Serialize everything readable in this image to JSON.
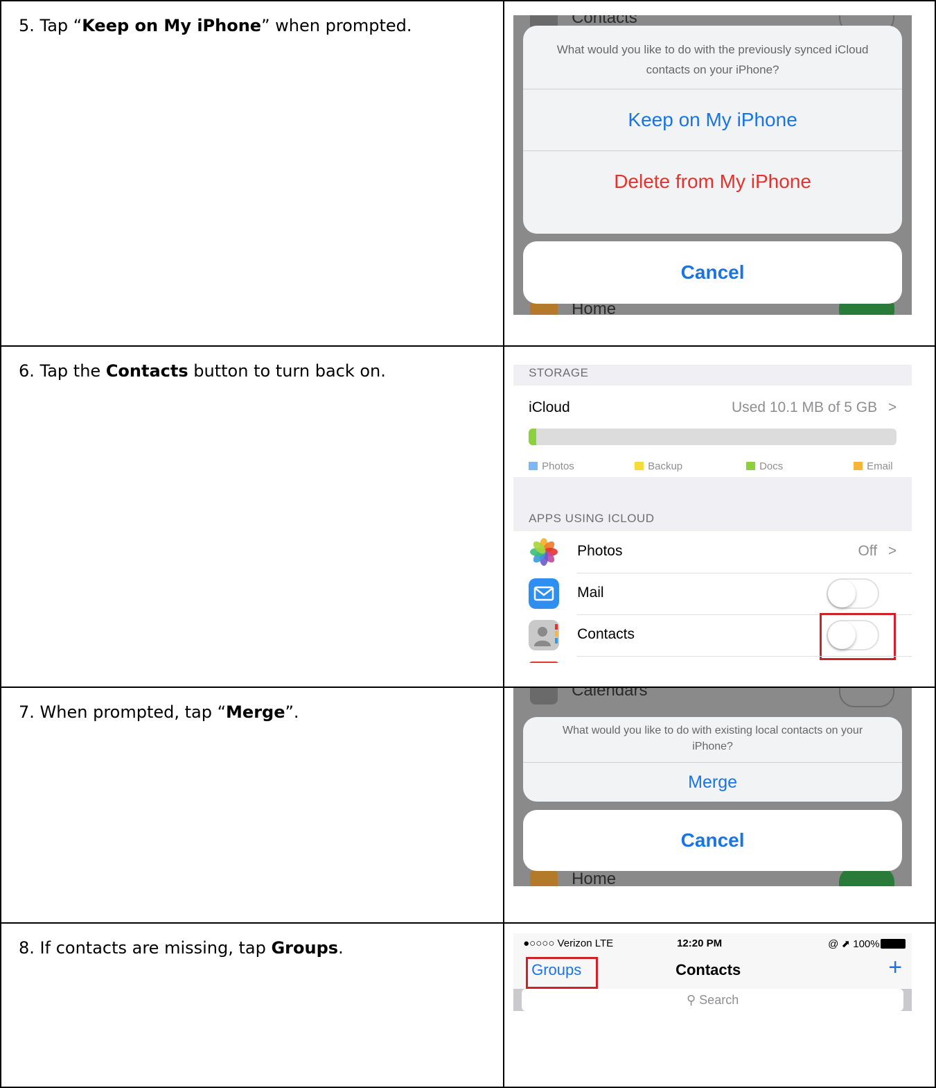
{
  "steps": [
    {
      "number": "5.",
      "text_before": " Tap “",
      "bold": "Keep on My iPhone",
      "text_after": "” when prompted.",
      "screen": {
        "top_item": "Contacts",
        "bottom_item": "Home",
        "message": "What would you like to do with the previously synced iCloud contacts on your iPhone?",
        "option_keep": "Keep on My iPhone",
        "option_delete": "Delete from My iPhone",
        "cancel": "Cancel"
      }
    },
    {
      "number": "6.",
      "text_before": " Tap the ",
      "bold": "Contacts",
      "text_after": " button to turn back on.",
      "screen": {
        "storage_header": "STORAGE",
        "icloud_label": "iCloud",
        "icloud_usage": "Used 10.1 MB of 5 GB",
        "usage_fraction": 0.02,
        "legend": [
          {
            "label": "Photos",
            "color": "#7fb8f0"
          },
          {
            "label": "Backup",
            "color": "#f5dc3a"
          },
          {
            "label": "Docs",
            "color": "#8ed03c"
          },
          {
            "label": "Email",
            "color": "#f6b63a"
          }
        ],
        "apps_header": "APPS USING ICLOUD",
        "apps": [
          {
            "label": "Photos",
            "value": "Off",
            "icon": "photos-icon"
          },
          {
            "label": "Mail",
            "icon": "mail-icon",
            "toggle": false
          },
          {
            "label": "Contacts",
            "icon": "contacts-icon",
            "toggle": false
          }
        ],
        "chevron": ">"
      }
    },
    {
      "number": "7.",
      "text_before": "  When prompted, tap “",
      "bold": "Merge",
      "text_after": "”.",
      "screen": {
        "top_item": "Calendars",
        "bottom_item": "Home",
        "message": "What would you like to do with existing local contacts on your iPhone?",
        "option_merge": "Merge",
        "cancel": "Cancel"
      }
    },
    {
      "number": "8.",
      "text_before": " If contacts are missing, tap ",
      "bold": "Groups",
      "text_after": ".",
      "screen": {
        "carrier": "●○○○○ Verizon  LTE",
        "time": "12:20 PM",
        "battery": "@ ⬈ 100%",
        "groups": "Groups",
        "title": "Contacts",
        "add": "+",
        "search_placeholder": "Search"
      }
    }
  ],
  "colors": {
    "ios_blue": "#1b74e4",
    "ios_red": "#e5322d",
    "highlight": "#d0202a"
  }
}
